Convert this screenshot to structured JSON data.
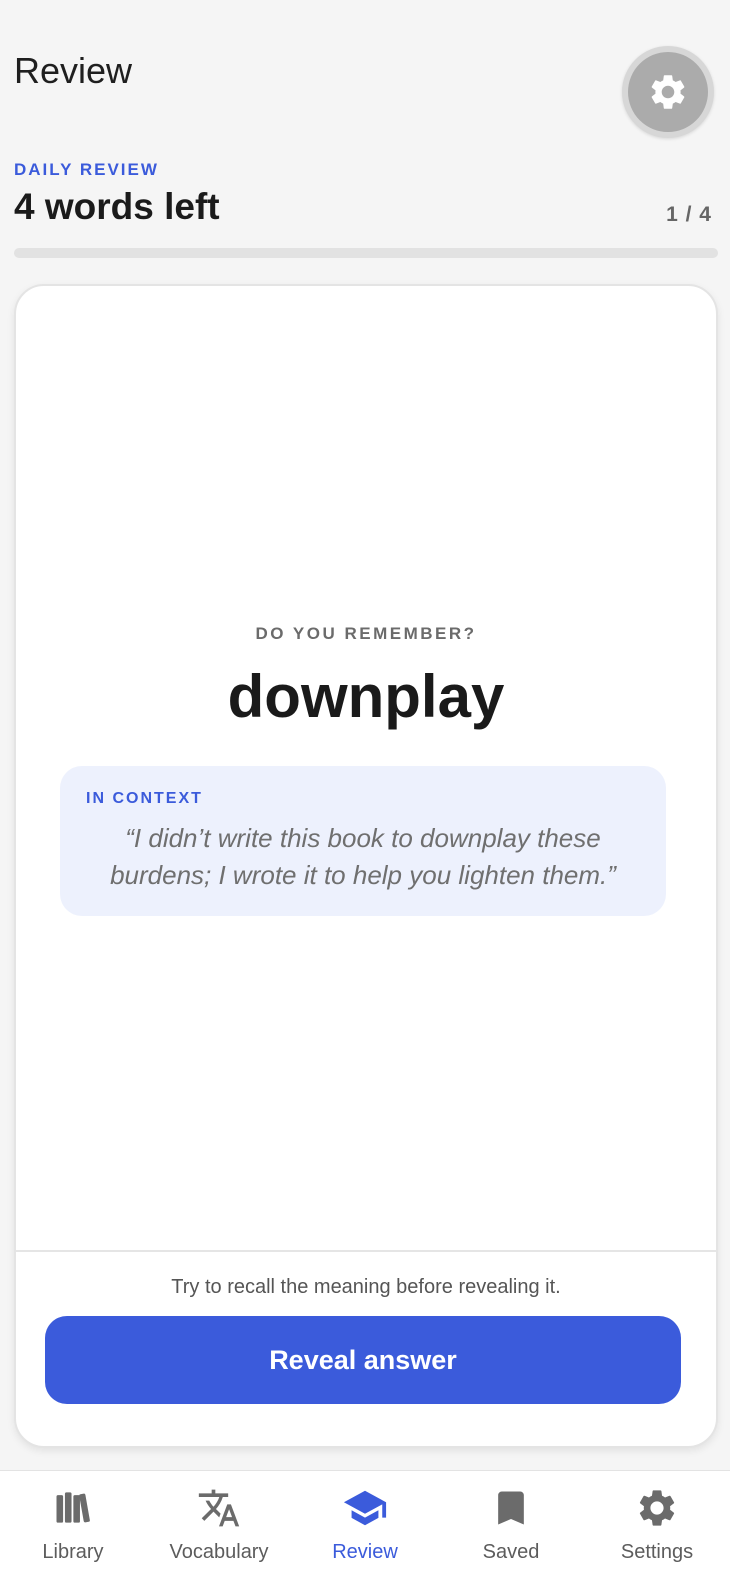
{
  "header": {
    "title": "Review"
  },
  "review": {
    "section_label": "DAILY REVIEW",
    "words_left": "4 words left",
    "counter": "1 / 4",
    "progress_fraction": 0.0
  },
  "card": {
    "prompt_label": "DO YOU REMEMBER?",
    "word": "downplay",
    "context_label": "IN CONTEXT",
    "context_quote": "“I didn’t write this book to downplay these burdens; I wrote it to help you lighten them.”",
    "hint": "Try to recall the meaning before revealing it.",
    "reveal_label": "Reveal answer"
  },
  "nav": {
    "items": [
      {
        "label": "Library",
        "icon": "library-icon"
      },
      {
        "label": "Vocabulary",
        "icon": "translate-icon"
      },
      {
        "label": "Review",
        "icon": "graduation-cap-icon",
        "active": true
      },
      {
        "label": "Saved",
        "icon": "bookmark-icon"
      },
      {
        "label": "Settings",
        "icon": "gear-icon"
      }
    ]
  },
  "colors": {
    "accent": "#3b5bdb",
    "background": "#f5f5f5",
    "context_bg": "#edf1fd",
    "inactive_icon": "#6b6b6b"
  }
}
